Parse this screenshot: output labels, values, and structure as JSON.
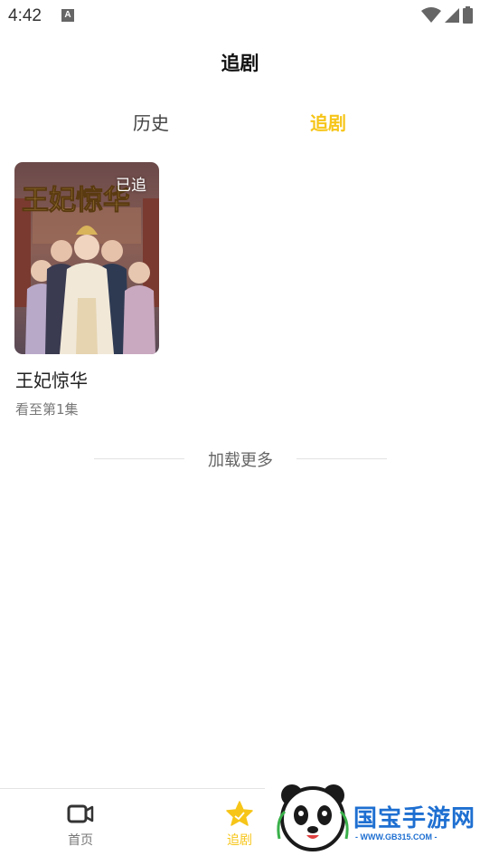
{
  "status_bar": {
    "time": "4:42",
    "notification_icon": "A"
  },
  "page": {
    "title": "追剧"
  },
  "tabs": [
    {
      "label": "历史",
      "active": false
    },
    {
      "label": "追剧",
      "active": true
    }
  ],
  "card": {
    "title": "王妃惊华",
    "progress": "看至第1集",
    "badge": "已追",
    "poster_title": "王妃惊华"
  },
  "load_more": {
    "label": "加载更多"
  },
  "bottom_nav": {
    "items": [
      {
        "label": "首页",
        "icon": "video-icon",
        "active": false
      },
      {
        "label": "追剧",
        "icon": "star-icon",
        "active": true
      }
    ]
  },
  "watermark": {
    "text": "国宝手游网",
    "url": "- WWW.GB315.COM -"
  },
  "colors": {
    "accent": "#f6c518",
    "watermark_blue": "#1e6fd1"
  }
}
